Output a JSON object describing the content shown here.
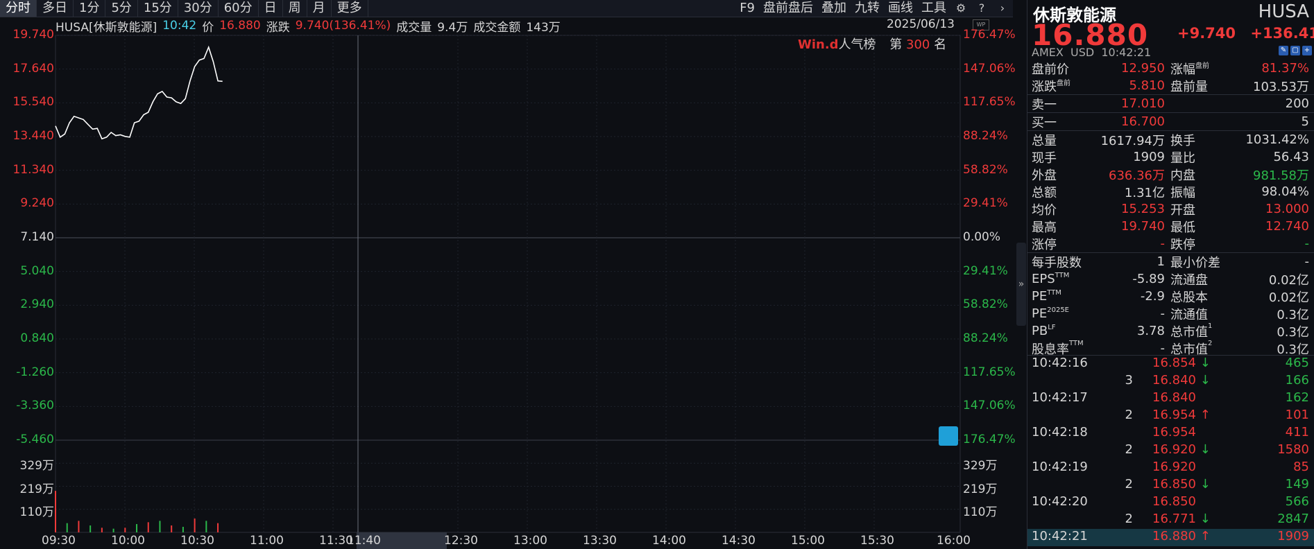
{
  "colors": {
    "up": "#f03a3a",
    "down": "#2bb84a",
    "bg": "#0d0f14",
    "line": "#ffffff"
  },
  "toolbar": {
    "tabs": [
      "分时",
      "多日",
      "1分",
      "5分",
      "15分",
      "30分",
      "60分",
      "日",
      "周",
      "月",
      "更多"
    ],
    "active_tab": "分时",
    "right": [
      "F9",
      "盘前盘后",
      "叠加",
      "九转",
      "画线",
      "工具"
    ]
  },
  "infobar": {
    "ticker": "HUSA[休斯敦能源]",
    "time": "10:42",
    "price_label": "价",
    "price": "16.880",
    "change_label": "涨跌",
    "change": "9.740(136.41%)",
    "vol_label": "成交量",
    "vol": "9.4万",
    "amount_label": "成交金额",
    "amount": "143万",
    "date": "2025/06/13"
  },
  "ranking": {
    "logo": "Win.d",
    "label": "人气榜",
    "prefix": "第",
    "rank": "300",
    "suffix": "名"
  },
  "left_axis": {
    "price_up": [
      "19.740",
      "17.640",
      "15.540",
      "13.440",
      "11.340",
      "9.240"
    ],
    "price_mid": "7.140",
    "price_down": [
      "5.040",
      "2.940",
      "0.840",
      "-1.260",
      "-3.360",
      "-5.460"
    ],
    "volume": [
      "329万",
      "219万",
      "110万"
    ]
  },
  "right_axis": {
    "pct_up": [
      "176.47%",
      "147.06%",
      "117.65%",
      "88.24%",
      "58.82%",
      "29.41%"
    ],
    "pct_mid": "0.00%",
    "pct_down": [
      "29.41%",
      "58.82%",
      "88.24%",
      "117.65%",
      "147.06%",
      "176.47%"
    ],
    "volume": [
      "329万",
      "219万",
      "110万"
    ]
  },
  "time_axis": [
    "09:30",
    "10:00",
    "10:30",
    "11:00",
    "11:30",
    "11:40",
    "12:30",
    "13:00",
    "13:30",
    "14:00",
    "14:30",
    "15:00",
    "15:30",
    "16:00"
  ],
  "chart_data": {
    "type": "line",
    "title": "HUSA[休斯敦能源]",
    "x_range": [
      "09:30",
      "16:00"
    ],
    "ylim": [
      -5.46,
      19.74
    ],
    "ref_price": 7.14,
    "series": [
      {
        "x": [
          "09:30",
          "09:32",
          "09:34",
          "09:36",
          "09:38",
          "09:40",
          "09:42",
          "09:44",
          "09:46",
          "09:48",
          "09:50",
          "09:52",
          "09:54",
          "09:56",
          "09:58",
          "10:00",
          "10:02",
          "10:04",
          "10:06",
          "10:08",
          "10:10",
          "10:12",
          "10:14",
          "10:16",
          "10:18",
          "10:20",
          "10:22",
          "10:24",
          "10:26",
          "10:28",
          "10:30",
          "10:32",
          "10:34",
          "10:36",
          "10:38",
          "10:40",
          "10:42"
        ],
        "values": [
          14.1,
          13.4,
          13.6,
          14.3,
          14.7,
          14.6,
          14.5,
          14.2,
          13.9,
          13.95,
          13.3,
          13.4,
          13.7,
          13.5,
          13.55,
          13.45,
          13.4,
          14.3,
          14.4,
          14.8,
          14.95,
          15.6,
          16.1,
          16.25,
          15.9,
          15.85,
          15.6,
          15.5,
          15.8,
          16.9,
          17.8,
          18.2,
          18.3,
          19.0,
          18.1,
          16.9,
          16.88
        ]
      }
    ],
    "volume_series": {
      "x": [
        "09:30",
        "09:35",
        "09:40",
        "09:45",
        "09:50",
        "09:55",
        "10:00",
        "10:05",
        "10:10",
        "10:15",
        "10:20",
        "10:25",
        "10:30",
        "10:35",
        "10:40"
      ],
      "values": [
        90,
        20,
        25,
        15,
        10,
        8,
        10,
        18,
        22,
        25,
        15,
        12,
        30,
        25,
        20
      ]
    }
  },
  "panel": {
    "name": "休斯敦能源",
    "code": "HUSA",
    "price": "16.880",
    "change": "+9.740",
    "change_pct": "+136.41%",
    "exchange": "AMEX",
    "currency": "USD",
    "time": "10:42:21",
    "rows": [
      {
        "l1": "盘前价",
        "v1": "12.950",
        "c1": "red",
        "l2": "涨幅",
        "s2": "盘前",
        "v2": "81.37%",
        "c2": "red"
      },
      {
        "l1": "涨跌",
        "s1": "盘前",
        "v1": "5.810",
        "c1": "red",
        "l2": "盘前量",
        "v2": "103.53万",
        "c2": "white",
        "sep": true
      },
      {
        "l1": "卖一",
        "v1": "17.010",
        "c1": "red",
        "v2": "200",
        "c2": "white",
        "sep": true
      },
      {
        "l1": "买一",
        "v1": "16.700",
        "c1": "red",
        "v2": "5",
        "c2": "white",
        "sep": true
      },
      {
        "l1": "总量",
        "v1": "1617.94万",
        "c1": "white",
        "l2": "换手",
        "v2": "1031.42%",
        "c2": "white"
      },
      {
        "l1": "现手",
        "v1": "1909",
        "c1": "white",
        "l2": "量比",
        "v2": "56.43",
        "c2": "white"
      },
      {
        "l1": "外盘",
        "v1": "636.36万",
        "c1": "red",
        "l2": "内盘",
        "v2": "981.58万",
        "c2": "green"
      },
      {
        "l1": "总额",
        "v1": "1.31亿",
        "c1": "white",
        "l2": "振幅",
        "v2": "98.04%",
        "c2": "white"
      },
      {
        "l1": "均价",
        "v1": "15.253",
        "c1": "red",
        "l2": "开盘",
        "v2": "13.000",
        "c2": "red"
      },
      {
        "l1": "最高",
        "v1": "19.740",
        "c1": "red",
        "l2": "最低",
        "v2": "12.740",
        "c2": "red"
      },
      {
        "l1": "涨停",
        "v1": "-",
        "c1": "red",
        "l2": "跌停",
        "v2": "-",
        "c2": "green",
        "sep": true
      },
      {
        "l1": "每手股数",
        "v1": "1",
        "c1": "white",
        "l2": "最小价差",
        "v2": "-",
        "c2": "white"
      },
      {
        "l1": "EPS",
        "s1": "TTM",
        "v1": "-5.89",
        "c1": "white",
        "l2": "流通盘",
        "v2": "0.02亿",
        "c2": "white"
      },
      {
        "l1": "PE",
        "s1": "TTM",
        "v1": "-2.9",
        "c1": "white",
        "l2": "总股本",
        "v2": "0.02亿",
        "c2": "white"
      },
      {
        "l1": "PE",
        "s1": "2025E",
        "v1": "-",
        "c1": "white",
        "l2": "流通值",
        "v2": "0.3亿",
        "c2": "white"
      },
      {
        "l1": "PB",
        "s1": "LF",
        "v1": "3.78",
        "c1": "white",
        "l2": "总市值",
        "s2": "1",
        "v2": "0.3亿",
        "c2": "white"
      },
      {
        "l1": "股息率",
        "s1": "TTM",
        "v1": "-",
        "c1": "white",
        "l2": "总市值",
        "s2": "2",
        "v2": "0.3亿",
        "c2": "white"
      }
    ],
    "ticks": [
      {
        "time": "10:42:16",
        "price": "16.854",
        "arrow": "down",
        "vol": "465",
        "vc": "green"
      },
      {
        "time": "3",
        "price": "16.840",
        "arrow": "down",
        "vol": "166",
        "vc": "green"
      },
      {
        "time": "10:42:17",
        "price": "16.840",
        "arrow": "",
        "vol": "162",
        "vc": "green"
      },
      {
        "time": "2",
        "price": "16.954",
        "arrow": "up",
        "vol": "101",
        "vc": "red"
      },
      {
        "time": "10:42:18",
        "price": "16.954",
        "arrow": "",
        "vol": "411",
        "vc": "red"
      },
      {
        "time": "2",
        "price": "16.920",
        "arrow": "down",
        "vol": "1580",
        "vc": "red"
      },
      {
        "time": "10:42:19",
        "price": "16.920",
        "arrow": "",
        "vol": "85",
        "vc": "red"
      },
      {
        "time": "2",
        "price": "16.850",
        "arrow": "down",
        "vol": "149",
        "vc": "green"
      },
      {
        "time": "10:42:20",
        "price": "16.850",
        "arrow": "",
        "vol": "566",
        "vc": "green"
      },
      {
        "time": "2",
        "price": "16.771",
        "arrow": "down",
        "vol": "2847",
        "vc": "green"
      },
      {
        "time": "10:42:21",
        "price": "16.880",
        "arrow": "up",
        "vol": "1909",
        "vc": "red"
      }
    ]
  }
}
